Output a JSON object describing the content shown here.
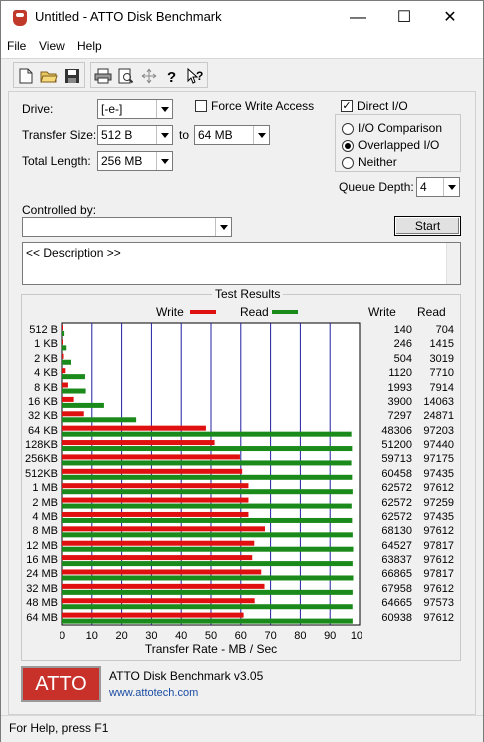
{
  "window": {
    "title": "Untitled - ATTO Disk Benchmark",
    "minimize": "—",
    "maximize": "☐",
    "close": "✕"
  },
  "menu": [
    "File",
    "View",
    "Help"
  ],
  "toolbar": {
    "icons": [
      "new-file-icon",
      "open-folder-icon",
      "save-icon",
      "print-icon",
      "print-preview-icon",
      "move-icon",
      "help-icon",
      "context-help-icon"
    ]
  },
  "form": {
    "drive_label": "Drive:",
    "drive_value": "[-e-]",
    "force_write_label": "Force Write Access",
    "force_write_checked": false,
    "direct_io_label": "Direct I/O",
    "direct_io_checked": true,
    "transfer_size_label": "Transfer Size:",
    "transfer_from": "512 B",
    "to_label": "to",
    "transfer_to": "64 MB",
    "total_length_label": "Total Length:",
    "total_length": "256 MB",
    "io_comparison_label": "I/O Comparison",
    "overlapped_io_label": "Overlapped I/O",
    "neither_label": "Neither",
    "selected_io_mode": "Overlapped I/O",
    "queue_depth_label": "Queue Depth:",
    "queue_depth": "4",
    "controlled_by_label": "Controlled by:",
    "controlled_by_value": "",
    "start_label": "Start",
    "description": "<< Description >>"
  },
  "results": {
    "title": "Test Results",
    "write_legend": "Write",
    "read_legend": "Read",
    "write_col": "Write",
    "read_col": "Read",
    "xlabel": "Transfer Rate - MB / Sec",
    "write_color": "#e01010",
    "read_color": "#1a8a1a"
  },
  "chart_data": {
    "type": "bar",
    "categories": [
      "512 B",
      "1 KB",
      "2 KB",
      "4 KB",
      "8 KB",
      "16 KB",
      "32 KB",
      "64 KB",
      "128KB",
      "256KB",
      "512KB",
      "1 MB",
      "2 MB",
      "4 MB",
      "8 MB",
      "12 MB",
      "16 MB",
      "24 MB",
      "32 MB",
      "48 MB",
      "64 MB"
    ],
    "series": [
      {
        "name": "Write",
        "values": [
          140,
          246,
          504,
          1120,
          1993,
          3900,
          7297,
          48306,
          51200,
          59713,
          60458,
          62572,
          62572,
          62572,
          68130,
          64527,
          63837,
          66865,
          67958,
          64665,
          60938
        ]
      },
      {
        "name": "Read",
        "values": [
          704,
          1415,
          3019,
          7710,
          7914,
          14063,
          24871,
          97203,
          97440,
          97175,
          97435,
          97612,
          97259,
          97435,
          97612,
          97817,
          97612,
          97817,
          97612,
          97573,
          97612
        ]
      }
    ],
    "write_display": [
      "140",
      "246",
      "504",
      "1120",
      "1993",
      "3900",
      "7297",
      "48306",
      "51200",
      "59713",
      "60458",
      "62572",
      "62572",
      "62572",
      "68130",
      "64527",
      "63837",
      "66865",
      "67958",
      "64665",
      "60938"
    ],
    "read_display": [
      "704",
      "1415",
      "3019",
      "7710",
      "7914",
      "14063",
      "24871",
      "97203",
      "97440",
      "97175",
      "97435",
      "97612",
      "97259",
      "97435",
      "97612",
      "97817",
      "97612",
      "97817",
      "97612",
      "97573",
      "97612"
    ],
    "xticks": [
      "0",
      "10",
      "20",
      "30",
      "40",
      "50",
      "60",
      "70",
      "80",
      "90",
      "100"
    ],
    "xlim": [
      0,
      100
    ],
    "xlabel": "Transfer Rate - MB / Sec",
    "grid": true,
    "legend": "top"
  },
  "footer": {
    "logo": "ATTO",
    "product": "ATTO Disk Benchmark v3.05",
    "url": "www.attotech.com"
  },
  "status": "For Help, press F1"
}
